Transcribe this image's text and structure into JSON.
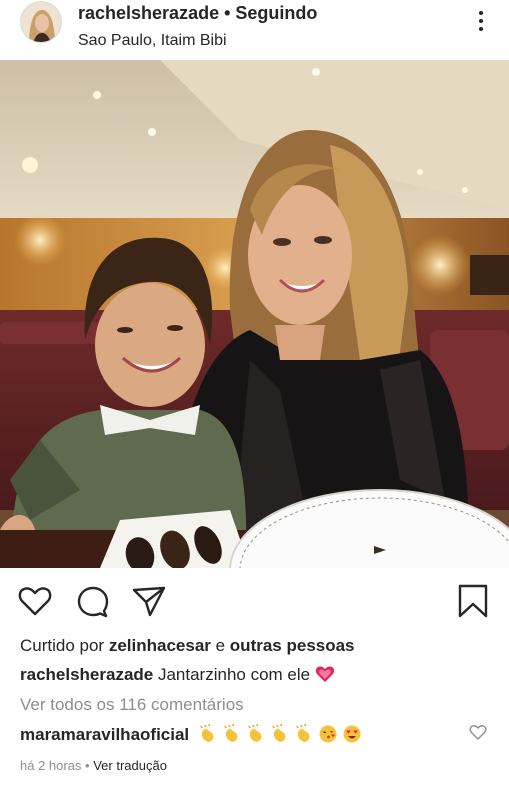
{
  "header": {
    "username": "rachelsherazade",
    "separator": " • ",
    "follow_status": "Seguindo",
    "location": "Sao Paulo, Itaim Bibi",
    "more_icon": "vertical-dots-icon"
  },
  "actions": {
    "like_icon": "heart-outline-icon",
    "comment_icon": "comment-bubble-icon",
    "share_icon": "paper-plane-icon",
    "save_icon": "bookmark-icon"
  },
  "likes": {
    "prefix": "Curtido por ",
    "user": "zelinhacesar",
    "middle": " e ",
    "others": "outras pessoas"
  },
  "caption": {
    "user": "rachelsherazade",
    "text": " Jantarzinho com ele ",
    "emoji": "heart-emoji"
  },
  "view_comments": "Ver todos os 116 comentários",
  "comment": {
    "user": "maramaravilhaoficial",
    "emojis": [
      "clapping-hands",
      "clapping-hands",
      "clapping-hands",
      "clapping-hands",
      "clapping-hands",
      "kissing-face-heart",
      "heart-eyes-face"
    ]
  },
  "meta": {
    "time": "há 2 horas",
    "separator": " • ",
    "translate": "Ver tradução"
  },
  "colors": {
    "text": "#262626",
    "secondary": "#8e8e8e",
    "heart_emoji": "#e0245e",
    "emoji_yellow": "#f7c13a"
  }
}
